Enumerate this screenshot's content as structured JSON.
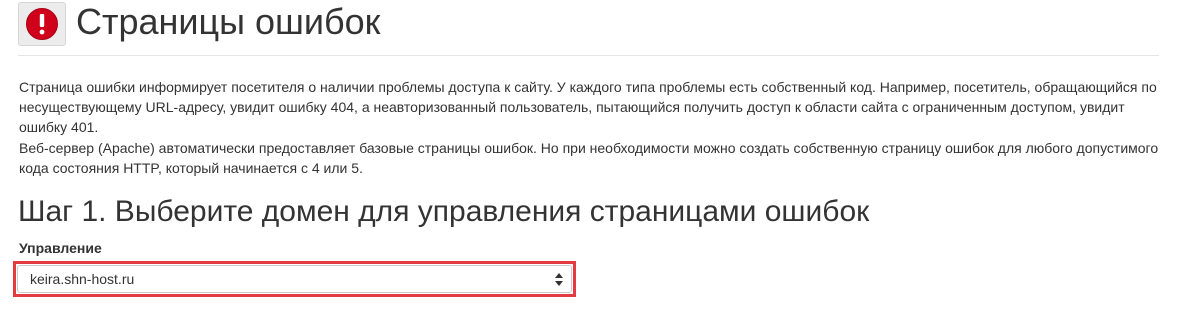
{
  "header": {
    "icon": "exclamation-circle-icon",
    "title": "Страницы ошибок"
  },
  "description": {
    "paragraph_1": "Страница ошибки информирует посетителя о наличии проблемы доступа к сайту. У каждого типа проблемы есть собственный код. Например, посетитель, обращающийся по несуществующему URL-адресу, увидит ошибку 404, а неавторизованный пользователь, пытающийся получить доступ к области сайта с ограниченным доступом, увидит ошибку 401.",
    "paragraph_2": "Веб-сервер (Apache) автоматически предоставляет базовые страницы ошибок. Но при необходимости можно создать собственную страницу ошибок для любого допустимого кода состояния HTTP, который начинается с 4 или 5."
  },
  "step": {
    "title": "Шаг 1. Выберите домен для управления страницами ошибок",
    "field_label": "Управление",
    "selected_domain": "keira.shn-host.ru",
    "select_icon": "updown-arrows-icon"
  },
  "colors": {
    "icon_red": "#d0021b",
    "highlight_red": "#e33b41",
    "text": "#333333"
  }
}
